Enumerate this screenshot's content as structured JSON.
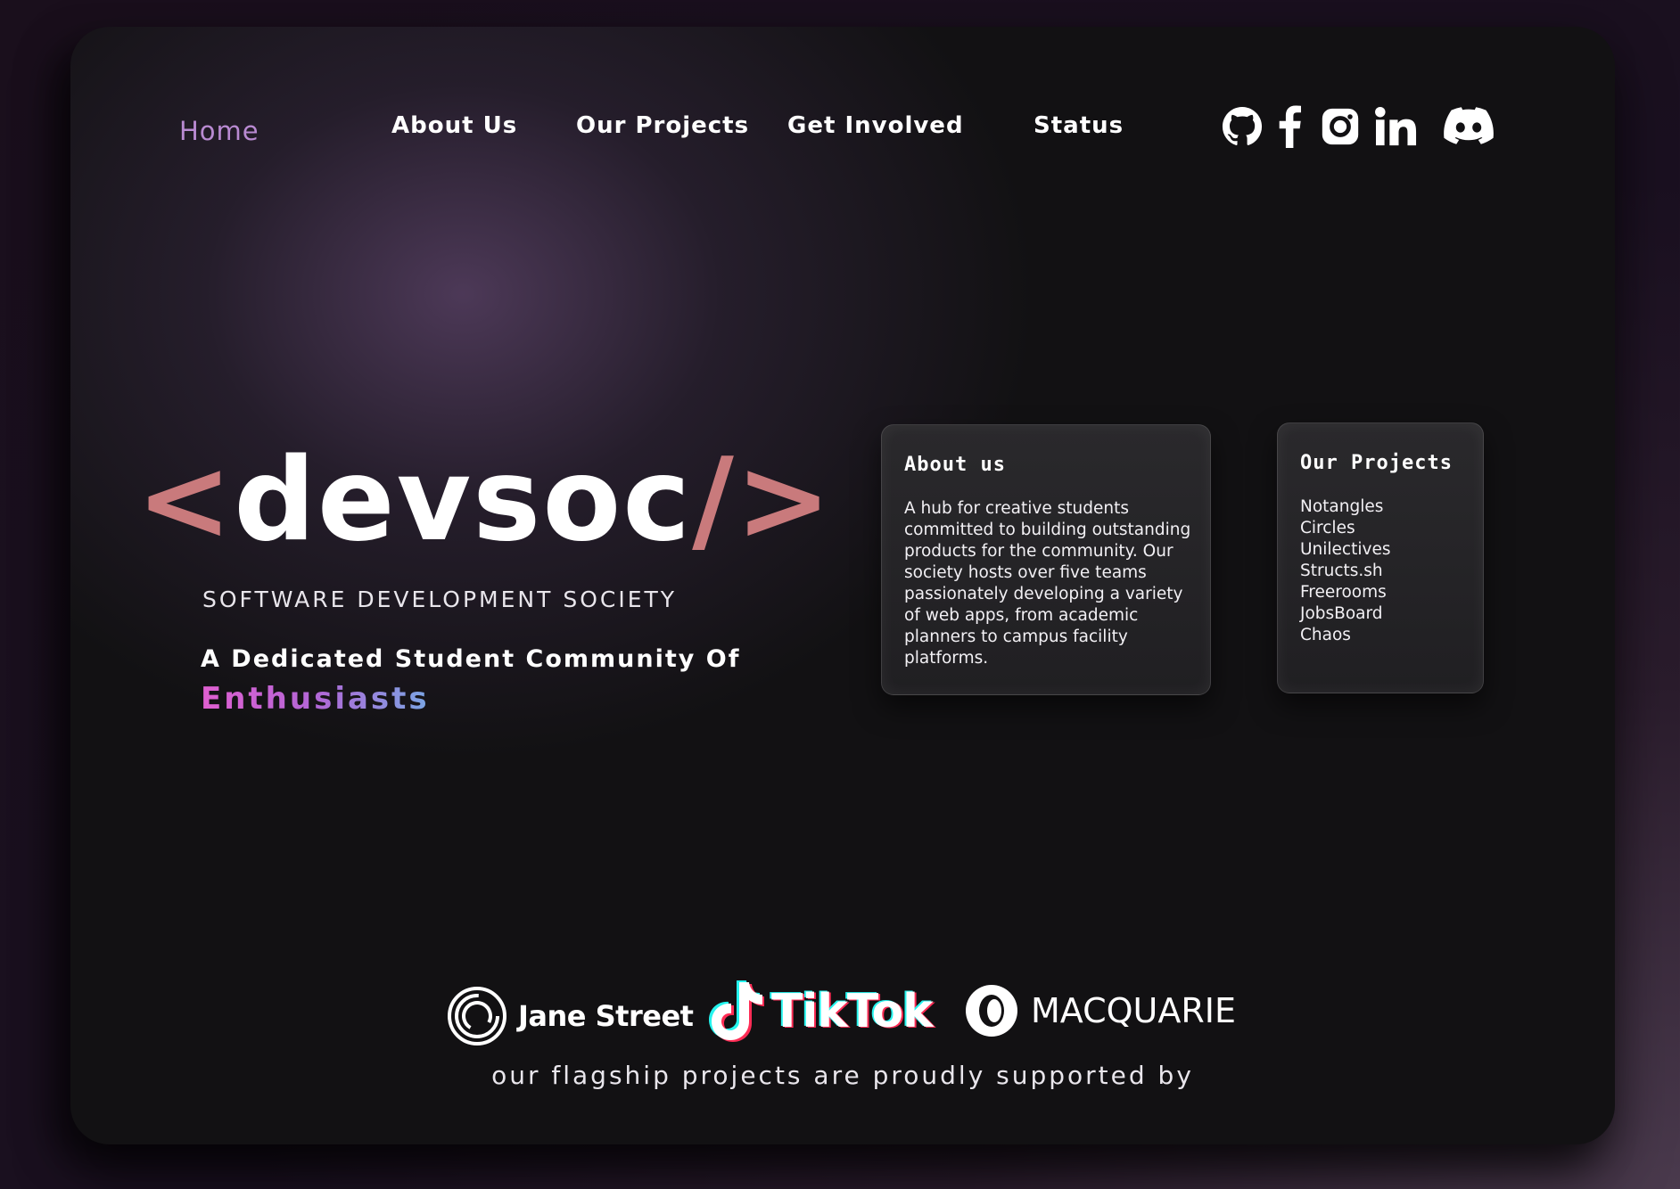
{
  "nav": {
    "home": "Home",
    "about": "About Us",
    "projects": "Our Projects",
    "involved": "Get Involved",
    "status": "Status"
  },
  "social": [
    "github-icon",
    "facebook-icon",
    "instagram-icon",
    "linkedin-icon",
    "discord-icon"
  ],
  "hero": {
    "bracket_open": "<",
    "name": "devsoc",
    "bracket_close": "/>",
    "subtitle": "SOFTWARE DEVELOPMENT SOCIETY",
    "tagline": "A Dedicated Student Community Of",
    "tagline_accent": "Enthusiasts"
  },
  "about_card": {
    "title": "About us",
    "body": "A hub for creative students committed to building outstanding products for the community. Our society hosts over five teams passionately developing a variety of web apps, from academic planners to campus facility platforms."
  },
  "projects_card": {
    "title": "Our Projects",
    "items": [
      "Notangles",
      "Circles",
      "Unilectives",
      "Structs.sh",
      "Freerooms",
      "JobsBoard",
      "Chaos"
    ]
  },
  "sponsors": {
    "jane_street": "Jane Street",
    "tiktok": "TikTok",
    "macquarie": "MACQUARIE",
    "caption": "our flagship projects are proudly supported by"
  },
  "colors": {
    "accent_home": "#b98ad2",
    "bracket": "#c97a7c",
    "gradient_start": "#e05fd0",
    "gradient_end": "#7aa6e4"
  }
}
